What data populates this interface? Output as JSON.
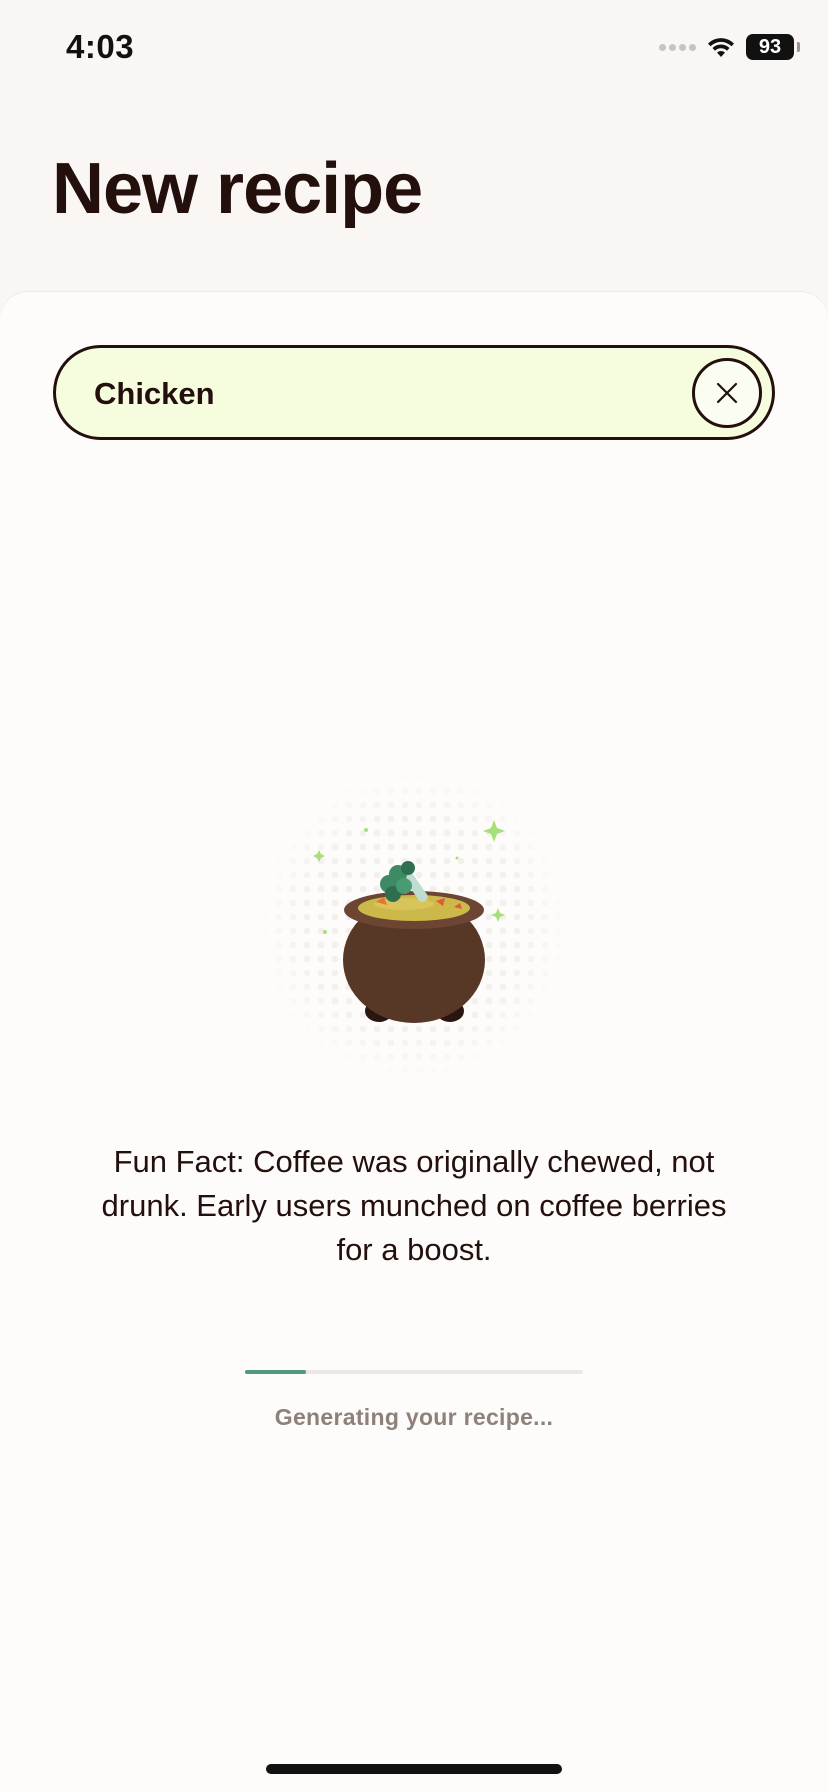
{
  "status_bar": {
    "time": "4:03",
    "battery": "93",
    "signal_icon": "signal-dots-icon",
    "wifi_icon": "wifi-icon"
  },
  "header": {
    "title": "New recipe"
  },
  "search": {
    "value": "Chicken",
    "clear_icon": "close-icon"
  },
  "loading": {
    "illustration": "cauldron-icon",
    "fun_fact": "Fun Fact: Coffee was originally chewed, not drunk. Early users munched on coffee berries for a boost.",
    "progress": 0.18,
    "status_text": "Generating your recipe..."
  },
  "colors": {
    "background": "#f9f6f4",
    "sheet": "#fefcfb",
    "text_primary": "#23100d",
    "search_fill": "#f5fdde",
    "accent_progress": "#4f9a7d",
    "status_text": "#8e807a",
    "cauldron": "#573726"
  }
}
